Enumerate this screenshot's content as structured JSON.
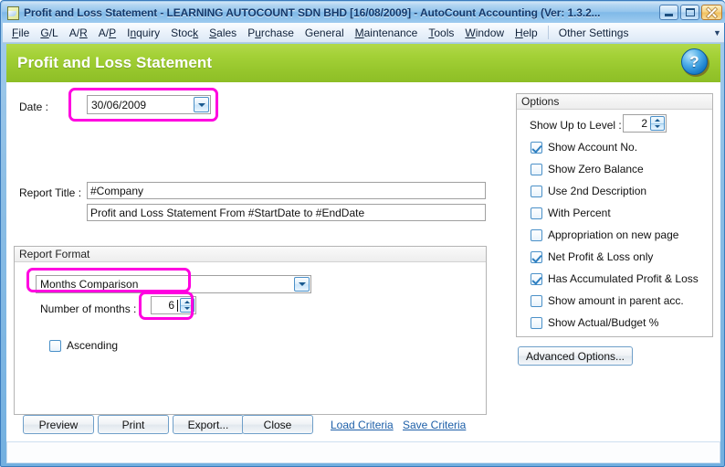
{
  "window": {
    "title": "Profit and Loss Statement - LEARNING AUTOCOUNT SDN BHD [16/08/2009] - AutoCount Accounting (Ver: 1.3.2...",
    "icon": "document-icon",
    "minimize_label": "Minimize",
    "maximize_label": "Maximize",
    "close_label": "Close"
  },
  "menubar": {
    "items": [
      {
        "label": "File"
      },
      {
        "label": "G/L"
      },
      {
        "label": "A/R"
      },
      {
        "label": "A/P"
      },
      {
        "label": "Inquiry"
      },
      {
        "label": "Stock"
      },
      {
        "label": "Sales"
      },
      {
        "label": "Purchase"
      },
      {
        "label": "General"
      },
      {
        "label": "Maintenance"
      },
      {
        "label": "Tools"
      },
      {
        "label": "Window"
      },
      {
        "label": "Help"
      }
    ],
    "extra": {
      "label": "Other Settings"
    },
    "overflow_icon": "chevron-down-icon"
  },
  "header": {
    "title": "Profit and Loss Statement",
    "help_icon": "help-question-icon",
    "band_color": "#a4d137"
  },
  "form": {
    "date": {
      "label": "Date :",
      "value": "30/06/2009",
      "dropdown_icon": "chevron-down-icon"
    },
    "report_title": {
      "label": "Report Title :",
      "line1": "#Company",
      "line2": "Profit and Loss Statement From #StartDate to #EndDate"
    },
    "report_format": {
      "title": "Report Format",
      "format": {
        "value": "Months Comparison",
        "dropdown_icon": "chevron-down-icon"
      },
      "number_of_months": {
        "label": "Number of months :",
        "value": "6",
        "up_icon": "chevron-up-icon",
        "down_icon": "chevron-down-icon"
      },
      "ascending": {
        "label": "Ascending",
        "checked": false
      }
    }
  },
  "options": {
    "title": "Options",
    "show_up_to_level": {
      "label": "Show Up to Level :",
      "value": "2",
      "up_icon": "chevron-up-icon",
      "down_icon": "chevron-down-icon"
    },
    "checkboxes": [
      {
        "label": "Show Account No.",
        "checked": true
      },
      {
        "label": "Show Zero Balance",
        "checked": false
      },
      {
        "label": "Use 2nd Description",
        "checked": false
      },
      {
        "label": "With Percent",
        "checked": false
      },
      {
        "label": "Appropriation on new page",
        "checked": false
      },
      {
        "label": "Net Profit & Loss only",
        "checked": true
      },
      {
        "label": "Has Accumulated Profit & Loss",
        "checked": true
      },
      {
        "label": "Show amount in parent acc.",
        "checked": false
      },
      {
        "label": "Show Actual/Budget %",
        "checked": false
      }
    ],
    "advanced_button": {
      "label": "Advanced Options..."
    }
  },
  "actions": {
    "buttons": [
      {
        "label": "Preview"
      },
      {
        "label": "Print"
      },
      {
        "label": "Export..."
      },
      {
        "label": "Close"
      }
    ],
    "links": [
      {
        "label": "Load Criteria"
      },
      {
        "label": "Save Criteria"
      }
    ]
  },
  "annotations": {
    "highlight_color": "#ff00e0",
    "regions": [
      {
        "name": "date-field-highlight"
      },
      {
        "name": "report-format-combo-highlight"
      },
      {
        "name": "number-of-months-highlight"
      }
    ]
  }
}
